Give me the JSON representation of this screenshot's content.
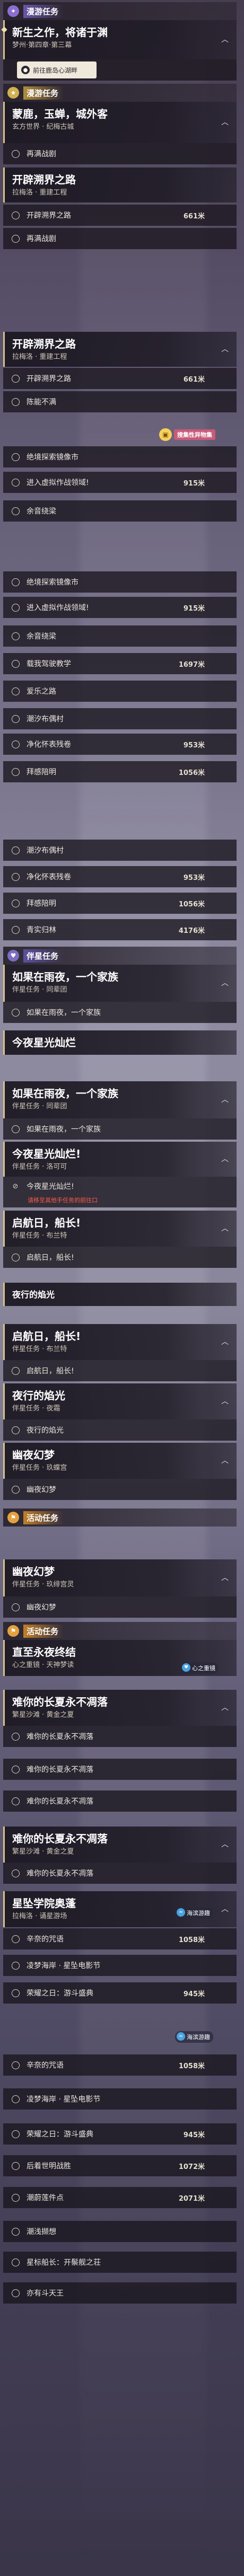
{
  "categories": {
    "side": "漫游任务",
    "hero": "漫游任务",
    "companion": "伴星任务",
    "event": "活动任务"
  },
  "head1": {
    "title": "新生之作，将诸于渊",
    "sub": "梦州·第四章·第三幕",
    "action": "前往鹿岛心湖畔"
  },
  "a_head1": {
    "title": "蒙鹿，玉蝉，城外客",
    "sub": "玄方世界 · 纪梅古城"
  },
  "a_s1": "再满战剧",
  "a_head2": {
    "title": "开辟溯界之路",
    "sub": "拉梅洛 · 重建工程"
  },
  "a_s2": {
    "label": "开辟溯界之路",
    "dist": "661米"
  },
  "a_s3": "再满战剧",
  "a_head3": {
    "title": "开辟溯界之路",
    "sub": "拉梅洛 · 重建工程"
  },
  "a_s4": {
    "label": "开辟溯界之路",
    "dist": "661米"
  },
  "a_s5": "陈能不满",
  "a_s6": "绝境探索镜像市",
  "a_s7": {
    "label": "进入虚拟作战领域!",
    "dist": "915米"
  },
  "a_s8": "余音绕梁",
  "badge1": "搜集性异物集",
  "b_s1": "绝境探索镜像市",
  "b_s2": {
    "label": "进入虚拟作战领域!",
    "dist": "915米"
  },
  "b_s3": "余音绕梁",
  "b_s4": {
    "label": "载我驾驶教学",
    "dist": "1697米"
  },
  "b_s5": "爱乐之路",
  "b_s6": "潮汐布偶村",
  "b_s7": {
    "label": "净化怀表残卷",
    "dist": "953米"
  },
  "b_s8": {
    "label": "拜感陪明",
    "dist": "1056米"
  },
  "b_s9": "潮汐布偶村",
  "b_s10": {
    "label": "净化怀表残卷",
    "dist": "953米"
  },
  "b_s11": {
    "label": "拜感陪明",
    "dist": "1056米"
  },
  "b_s12": {
    "label": "青实归林",
    "dist": "4176米"
  },
  "c_head1": {
    "title": "如果在雨夜，一个家族",
    "sub": "伴星任务 · 同辈团"
  },
  "c_s1": "如果在雨夜，一个家族",
  "c_head2": {
    "title": "今夜星光灿烂"
  },
  "c_head3": {
    "title": "如果在雨夜，一个家族",
    "sub": "伴星任务 · 同辈团"
  },
  "c_s2": "如果在雨夜，一个家族",
  "c_head4": {
    "title": "今夜星光灿烂!",
    "sub": "伴星任务 · 洛可可"
  },
  "c_s3": "今夜星光灿烂!",
  "c_note": "请移至其他手任务的前往口",
  "c_head5": {
    "title": "启航日，船长!",
    "sub": "伴星任务 · 布兰特"
  },
  "c_s4": "启航日，船长!",
  "c_head6": {
    "title": "夜行的焰光"
  },
  "c_head7": {
    "title": "启航日，船长!",
    "sub": "伴星任务 · 布兰特"
  },
  "c_s5": "启航日，船长!",
  "c_head8": {
    "title": "夜行的焰光",
    "sub": "伴星任务 · 夜霜"
  },
  "c_s6": "夜行的焰光",
  "c_head9": {
    "title": "幽夜幻梦",
    "sub": "伴星任务 · 玖蝶宫"
  },
  "c_s7": "幽夜幻梦",
  "d_head1": {
    "title": "幽夜幻梦",
    "sub": "伴星任务 · 玖绯宫灵"
  },
  "d_s1": "幽夜幻梦",
  "d_head2": {
    "title": "直至永夜终结",
    "sub": "心之重镜 · 天神梦读"
  },
  "pill1": "心之重镜",
  "d_head3": {
    "title": "难你的长夏永不凋落",
    "sub": "繁星沙滩 · 黄金之夏"
  },
  "d_s2": "难你的长夏永不凋落",
  "d_s3": "难你的长夏永不凋落",
  "d_s4": "难你的长夏永不凋落",
  "d_head4": {
    "title": "难你的长夏永不凋落",
    "sub": "繁星沙滩 · 黄金之夏"
  },
  "d_s5": "难你的长夏永不凋落",
  "d_head5": {
    "title": "星坠学院奥蓬",
    "sub": "拉梅洛 · 诵星游场"
  },
  "d_s6": {
    "label": "辛奈的咒语",
    "dist": "1058米"
  },
  "d_s7": "凌梦海岸 · 星坠电影节",
  "d_s8": {
    "label": "荣耀之日：游斗盛典",
    "dist": "945米"
  },
  "pill2": "海滨游趣",
  "e_s1": {
    "label": "辛奈的咒语",
    "dist": "1058米"
  },
  "e_s2": "凌梦海岸 · 星坠电影节",
  "e_s3": {
    "label": "荣耀之日：游斗盛典",
    "dist": "945米"
  },
  "e_s4": {
    "label": "后着世明战胜",
    "dist": "1072米"
  },
  "e_s5": {
    "label": "潮蔚莲件点",
    "dist": "2071米"
  },
  "e_s6": "潮浅撷想",
  "e_s7": "星标船长：开鬃舰之荘",
  "e_s8": "亦有斗天王",
  "pill3": "海滨游趣"
}
